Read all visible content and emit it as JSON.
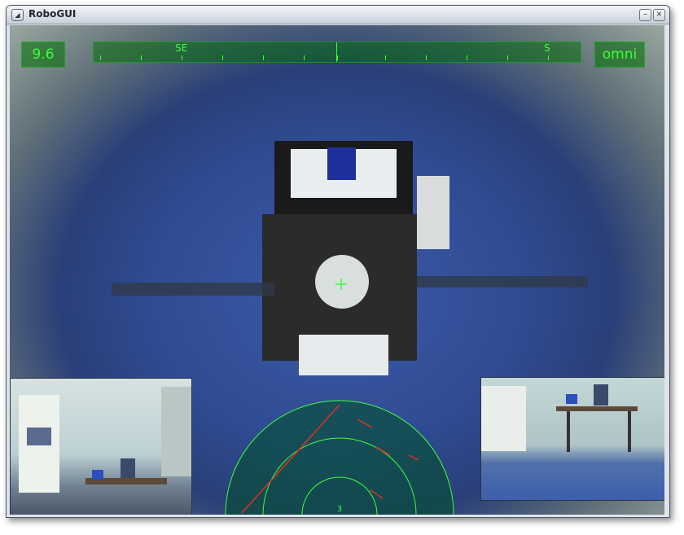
{
  "window": {
    "title": "RoboGUI",
    "icons": {
      "app": "app-menu-icon",
      "minimize": "minimize-icon",
      "close": "close-icon"
    }
  },
  "hud": {
    "left_value": "9.6",
    "right_mode": "omni",
    "compass": {
      "labels": [
        "SE",
        "S"
      ]
    },
    "radar": {
      "range_label": "3"
    },
    "color": "#3bff3b"
  }
}
